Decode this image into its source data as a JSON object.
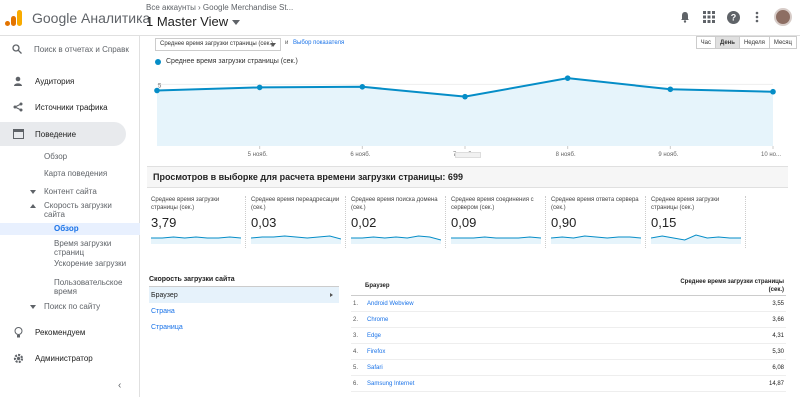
{
  "header": {
    "brand": "Google Аналитика",
    "account_breadcrumb": "Все аккаунты › Google Merchandise St...",
    "view_name": "1 Master View"
  },
  "sidebar": {
    "search_placeholder": "Поиск в отчетах и Справк",
    "items": [
      {
        "label": "Аудитория",
        "icon": "person-icon"
      },
      {
        "label": "Источники трафика",
        "icon": "acquisition-icon"
      },
      {
        "label": "Поведение",
        "icon": "behavior-icon"
      },
      {
        "label": "Рекомендуем",
        "icon": "lightbulb-icon"
      },
      {
        "label": "Администратор",
        "icon": "gear-icon"
      }
    ],
    "behavior_sub": {
      "overview": "Обзор",
      "behavior_flow": "Карта поведения",
      "site_content": "Контент сайта",
      "site_speed": "Скорость загрузки сайта",
      "speed_overview": "Обзор",
      "page_timings": "Время загрузки страниц",
      "speed_suggestions": "Ускорение загрузки",
      "user_timings": "Пользовательское время",
      "site_search": "Поиск по сайту"
    }
  },
  "controls": {
    "metric": "Среднее время загрузки страницы (сек.)",
    "and": "и",
    "pick_metric": "Выбор показателя",
    "periods": [
      "Час",
      "День",
      "Неделя",
      "Месяц"
    ],
    "selected_period": "День"
  },
  "chart_data": {
    "type": "area",
    "series": [
      {
        "name": "Среднее время загрузки страницы (сек.)",
        "values": [
          4.5,
          4.75,
          4.8,
          4.0,
          5.5,
          4.6,
          4.4
        ]
      }
    ],
    "y_ticks": [
      "5",
      "2,5"
    ],
    "ylim": [
      0,
      6.0
    ],
    "x_labels": [
      "5 нояб.",
      "6 нояб.",
      "7 нояб.",
      "8 нояб.",
      "9 нояб.",
      "10 но..."
    ],
    "color": "#058dc7"
  },
  "sampling_text": "Просмотров в выборке для расчета времени загрузки страницы: 699",
  "tiles": [
    {
      "label": "Среднее время загрузки страницы (сек.)",
      "value": "3,79"
    },
    {
      "label": "Среднее время переадресации (сек.)",
      "value": "0,03"
    },
    {
      "label": "Среднее время поиска домена (сек.)",
      "value": "0,02"
    },
    {
      "label": "Среднее время соединения с сервером (сек.)",
      "value": "0,09"
    },
    {
      "label": "Среднее время ответа сервера (сек.)",
      "value": "0,90"
    },
    {
      "label": "Среднее время загрузки страницы (сек.)",
      "value": "0,15"
    }
  ],
  "left_table": {
    "title": "Скорость загрузки сайта",
    "rows": [
      "Браузер",
      "Страна",
      "Страница"
    ]
  },
  "right_table": {
    "col_name": "Браузер",
    "col_value": "Среднее время загрузки страницы (сек.)",
    "rows": [
      {
        "idx": "1.",
        "name": "Android Webview",
        "value": "3,55"
      },
      {
        "idx": "2.",
        "name": "Chrome",
        "value": "3,66"
      },
      {
        "idx": "3.",
        "name": "Edge",
        "value": "4,31"
      },
      {
        "idx": "4.",
        "name": "Firefox",
        "value": "5,30"
      },
      {
        "idx": "5.",
        "name": "Safari",
        "value": "6,08"
      },
      {
        "idx": "6.",
        "name": "Samsung Internet",
        "value": "14,87"
      }
    ]
  }
}
